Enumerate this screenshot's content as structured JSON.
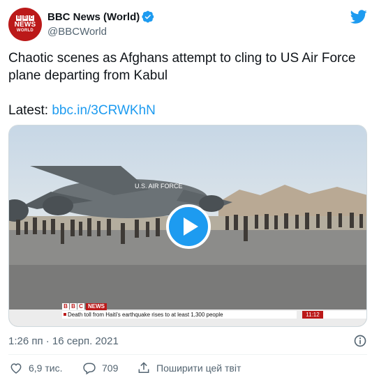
{
  "account": {
    "display_name": "BBC News (World)",
    "handle": "@BBCWorld",
    "avatar_letters": [
      "B",
      "B",
      "C"
    ],
    "avatar_news": "NEWS",
    "avatar_world": "WORLD"
  },
  "tweet": {
    "text": "Chaotic scenes as Afghans attempt to cling to US Air Force plane departing from Kabul",
    "latest_label": "Latest:",
    "link": "bbc.in/3CRWKhN"
  },
  "media": {
    "ticker_letters": [
      "B",
      "B",
      "C"
    ],
    "ticker_news": "NEWS",
    "ticker_headline": "Death toll from Haiti's earthquake rises to at least 1,300 people",
    "ticker_time": "11:12",
    "plane_marking": "U.S. AIR FORCE"
  },
  "meta": {
    "timestamp": "1:26 пп · 16 серп. 2021"
  },
  "actions": {
    "likes": "6,9 тис.",
    "replies": "709",
    "share_label": "Поширити цей твіт"
  },
  "colors": {
    "accent": "#1d9bf0",
    "brand_red": "#bb1919",
    "text_primary": "#0f1419",
    "text_secondary": "#536471"
  },
  "icons": [
    "verified-icon",
    "twitter-bird-icon",
    "play-icon",
    "info-icon",
    "heart-icon",
    "reply-icon",
    "share-icon"
  ]
}
